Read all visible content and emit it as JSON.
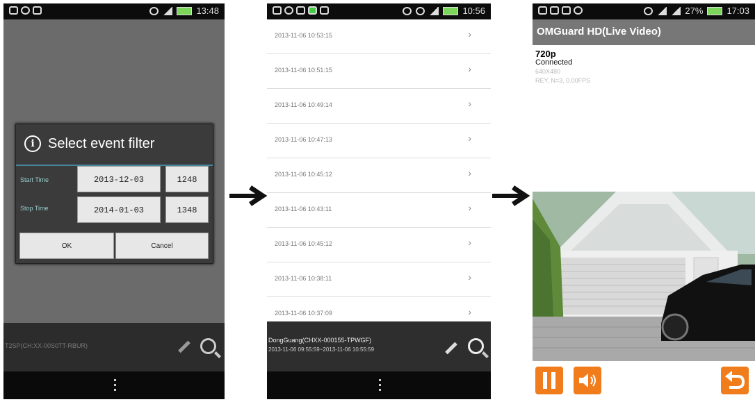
{
  "phone1": {
    "status_time": "13:48",
    "dialog": {
      "title": "Select event filter",
      "start_label": "Start Time",
      "start_date": "2013-12-03",
      "start_time": "1248",
      "stop_label": "Stop Time",
      "stop_date": "2014-01-03",
      "stop_time": "1348",
      "ok_label": "OK",
      "cancel_label": "Cancel"
    },
    "device_text": "T2SP(CH:XX-00S0TT-RBUR)"
  },
  "phone2": {
    "status_time": "10:56",
    "events": [
      {
        "time": "2013-11-06 10:53:15"
      },
      {
        "time": "2013-11-06 10:51:15"
      },
      {
        "time": "2013-11-06 10:49:14"
      },
      {
        "time": "2013-11-06 10:47:13"
      },
      {
        "time": "2013-11-06 10:45:12"
      },
      {
        "time": "2013-11-06 10:43:11"
      },
      {
        "time": "2013-11-06 10:45:12"
      },
      {
        "time": "2013-11-06 10:38:11"
      },
      {
        "time": "2013-11-06 10:37:09"
      }
    ],
    "device_name": "DongGuang(CHXX-000155-TPWGF)",
    "device_range": "2013-11-06 09:55:59~2013-11-06 10:55:59"
  },
  "phone3": {
    "status_time": "17:03",
    "battery": "27%",
    "app_title": "OMGuard HD(Live Video)",
    "resolution": "720p",
    "connection": "Connected",
    "frame_size": "640X480",
    "stats": "REY, N=3, 0.00FPS"
  },
  "colors": {
    "accent_orange": "#f17c1b",
    "dialog_divider": "#4aa6c8"
  }
}
